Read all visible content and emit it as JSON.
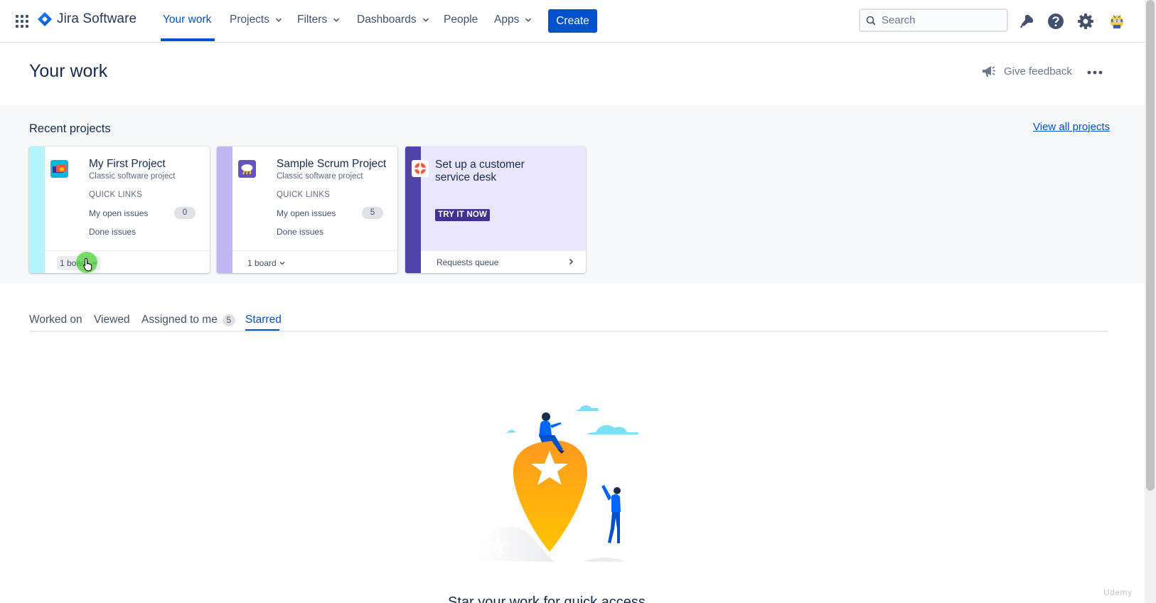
{
  "nav": {
    "product": "Jira Software",
    "items": [
      {
        "label": "Your work",
        "active": true,
        "dropdown": false
      },
      {
        "label": "Projects",
        "dropdown": true
      },
      {
        "label": "Filters",
        "dropdown": true
      },
      {
        "label": "Dashboards",
        "dropdown": true
      },
      {
        "label": "People",
        "dropdown": false
      },
      {
        "label": "Apps",
        "dropdown": true
      }
    ],
    "create_label": "Create",
    "search_placeholder": "Search",
    "icons": [
      "app-switcher-icon",
      "notifications-icon",
      "help-icon",
      "settings-icon",
      "avatar"
    ]
  },
  "header": {
    "title": "Your work",
    "feedback_label": "Give feedback",
    "more_icon": "more-icon"
  },
  "recent": {
    "title": "Recent projects",
    "view_all": "View all projects",
    "projects": [
      {
        "name": "My First Project",
        "type": "Classic software project",
        "quick_links_label": "QUICK LINKS",
        "open_issues_label": "My open issues",
        "open_issues_count": "0",
        "done_label": "Done issues",
        "board_label": "1 board",
        "stripe_color": "#b3f5ff"
      },
      {
        "name": "Sample Scrum Project",
        "type": "Classic software project",
        "quick_links_label": "QUICK LINKS",
        "open_issues_label": "My open issues",
        "open_issues_count": "5",
        "done_label": "Done issues",
        "board_label": "1 board",
        "stripe_color": "#c0b6f2"
      }
    ],
    "service_desk": {
      "title": "Set up a customer service desk",
      "cta": "TRY IT NOW",
      "link": "Requests queue",
      "stripe_color": "#5243aa",
      "background": "#eae6ff"
    }
  },
  "tabs": {
    "items": [
      {
        "label": "Worked on"
      },
      {
        "label": "Viewed"
      },
      {
        "label": "Assigned to me",
        "count": "5"
      },
      {
        "label": "Starred",
        "active": true
      }
    ]
  },
  "empty_state": {
    "text": "Star your work for quick access"
  },
  "watermark": "Udemy",
  "colors": {
    "brand_blue": "#0052cc",
    "text": "#172b4d",
    "muted": "#6b778c",
    "band_bg": "#f7f8f9",
    "cursor_highlight": "#4cd137"
  }
}
